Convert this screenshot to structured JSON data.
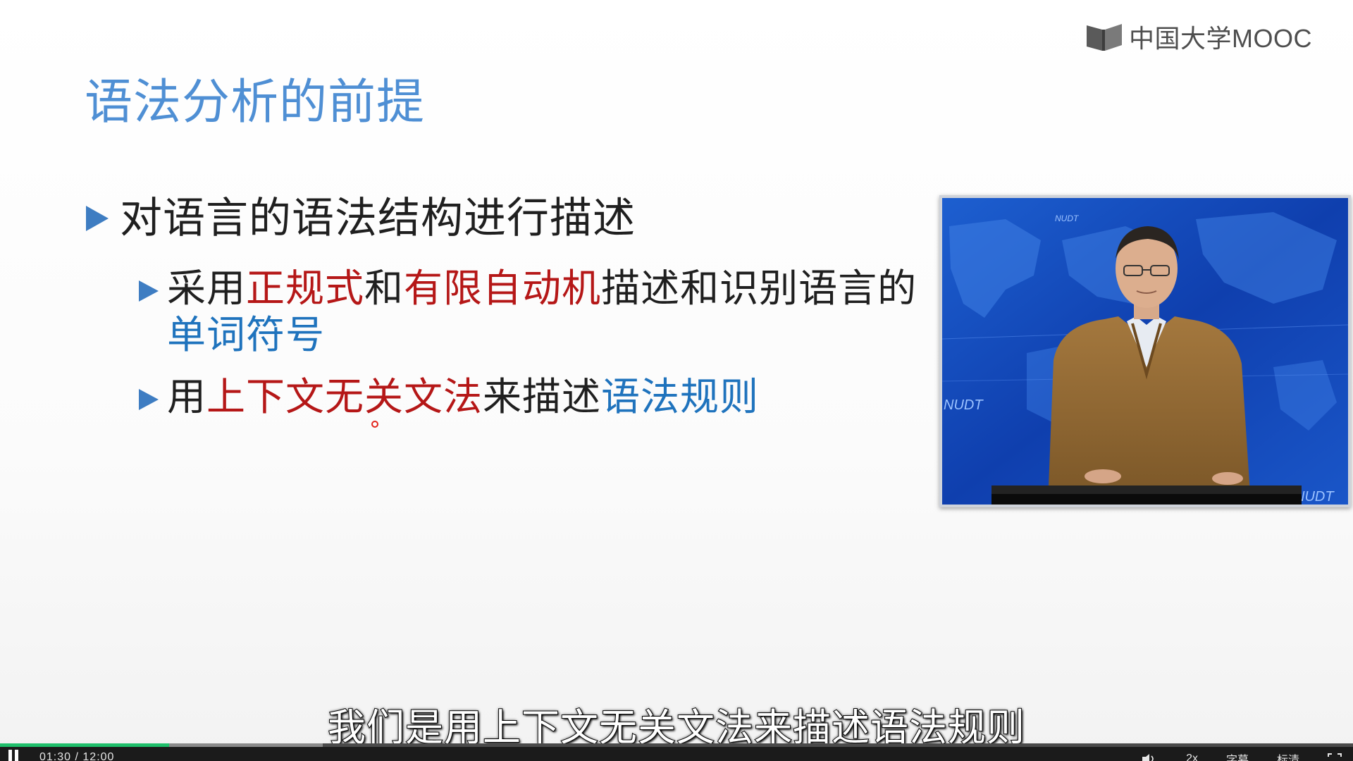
{
  "brand": {
    "logo_text": "中国大学MOOC"
  },
  "slide": {
    "title": "语法分析的前提",
    "bullet1": "对语言的语法结构进行描述",
    "bullet2": {
      "part1": "采用",
      "part2": "正规式",
      "part3": "和",
      "part4": "有限自动机",
      "part5": "描述和识别语言的",
      "part6": "单词符号"
    },
    "bullet3": {
      "part1": "用",
      "part2": "上下文无关文法",
      "part3": "来描述",
      "part4": "语法规则"
    }
  },
  "video": {
    "backdrop_label": "NUDT"
  },
  "subtitle": "我们是用上下文无关文法来描述语法规则",
  "player": {
    "current_time": "01:30",
    "duration": "12:00",
    "time_separator": "/",
    "progress_fraction": 0.125,
    "speed": "2x",
    "caption_label": "字幕",
    "quality_label": "标清",
    "colors": {
      "progress_played": "#1fbf6b",
      "bar_background": "#1b1b1b"
    }
  },
  "colors": {
    "title": "#4f8fd4",
    "emphasis_red": "#b51717",
    "emphasis_blue": "#1f73bd",
    "bullet_triangle": "#3e7dc2"
  }
}
